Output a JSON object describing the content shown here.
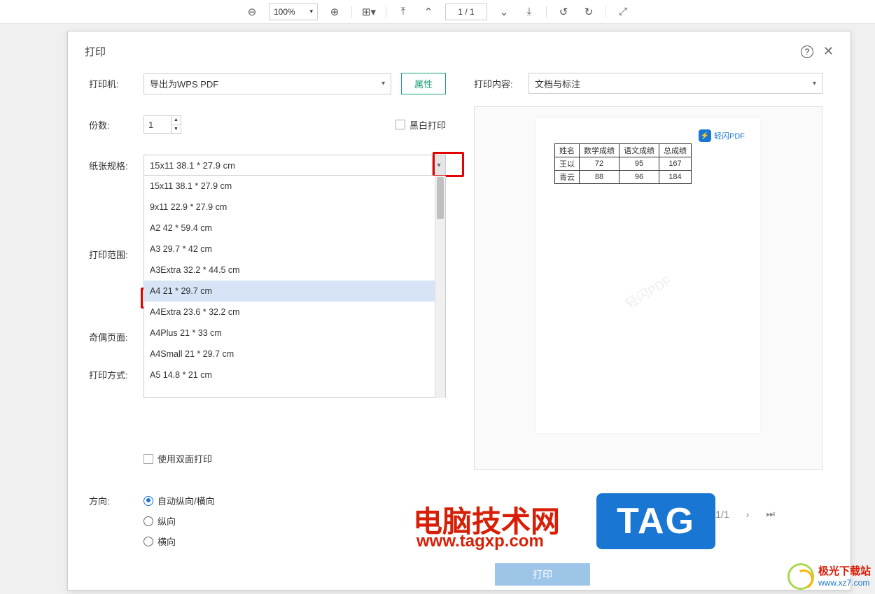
{
  "toolbar": {
    "zoom": "100%",
    "page_current": "1",
    "page_total": "1"
  },
  "dialog": {
    "title": "打印",
    "printer_label": "打印机:",
    "printer_value": "导出为WPS PDF",
    "properties_btn": "属性",
    "copies_label": "份数:",
    "copies_value": "1",
    "bw_print": "黑白打印",
    "paper_label": "纸张规格:",
    "paper_value": "15x11 38.1 * 27.9 cm",
    "paper_options": [
      "15x11 38.1 * 27.9 cm",
      "9x11 22.9 * 27.9 cm",
      "A2 42 * 59.4 cm",
      "A3 29.7 * 42 cm",
      "A3Extra 32.2 * 44.5 cm",
      "A4 21 * 29.7 cm",
      "A4Extra 23.6 * 32.2 cm",
      "A4Plus 21 * 33 cm",
      "A4Small 21 * 29.7 cm",
      "A5 14.8 * 21 cm"
    ],
    "print_range_label": "打印范围:",
    "odd_even_label": "奇偶页面:",
    "print_mode_label": "打印方式:",
    "duplex_label": "使用双面打印",
    "orientation_label": "方向:",
    "orientation_auto": "自动纵向/横向",
    "orientation_portrait": "纵向",
    "orientation_landscape": "横向",
    "print_content_label": "打印内容:",
    "print_content_value": "文档与标注",
    "print_button": "打印",
    "pager_text": "1/1",
    "qpdf_badge": "轻闪PDF",
    "watermark": "轻闪PDF"
  },
  "preview_table": {
    "headers": [
      "姓名",
      "数学成绩",
      "语文成绩",
      "总成绩"
    ],
    "rows": [
      [
        "王以",
        "72",
        "95",
        "167"
      ],
      [
        "青云",
        "88",
        "96",
        "184"
      ]
    ]
  },
  "overlay": {
    "main_text": "电脑技术网",
    "url_text": "www.tagxp.com",
    "tag_text": "TAG"
  },
  "footer_logo": {
    "cn": "极光下载站",
    "en": "www.xz7.com"
  }
}
